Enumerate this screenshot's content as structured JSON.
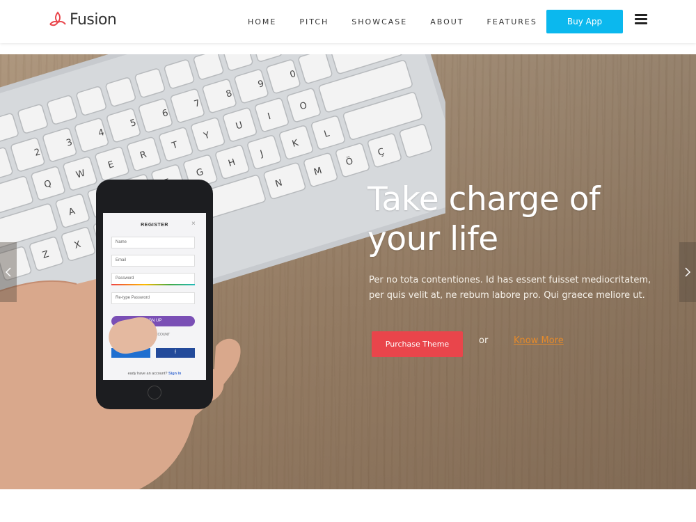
{
  "brand": {
    "name": "Fusion",
    "accent": "#e9454b"
  },
  "nav": {
    "items": [
      "HOME",
      "PITCH",
      "SHOWCASE",
      "ABOUT",
      "FEATURES"
    ],
    "buy_label": "Buy App",
    "buy_color": "#0bb8ee"
  },
  "hero": {
    "title_line1": "Take charge of",
    "title_line2": "your life",
    "description": "Per no tota contentiones. Id has essent fuisset mediocritatem, per quis velit at, ne rebum labore pro. Qui graece meliore ut.",
    "primary_label": "Purchase Theme",
    "or_text": "or",
    "secondary_label": "Know More"
  },
  "phone": {
    "title": "REGISTER",
    "fields": [
      "Name",
      "Email",
      "Password",
      "Re-type Password"
    ],
    "signup_label": "SIGN UP",
    "social_text": "A SOCIAL ACCOUNT",
    "fb_letter": "f",
    "footer_text": "eady have an account?",
    "footer_link": "Sign In"
  },
  "icons": {
    "prev": "chevron-left-icon",
    "next": "chevron-right-icon",
    "menu": "hamburger-menu-icon",
    "logo": "leaf-logo-icon"
  }
}
